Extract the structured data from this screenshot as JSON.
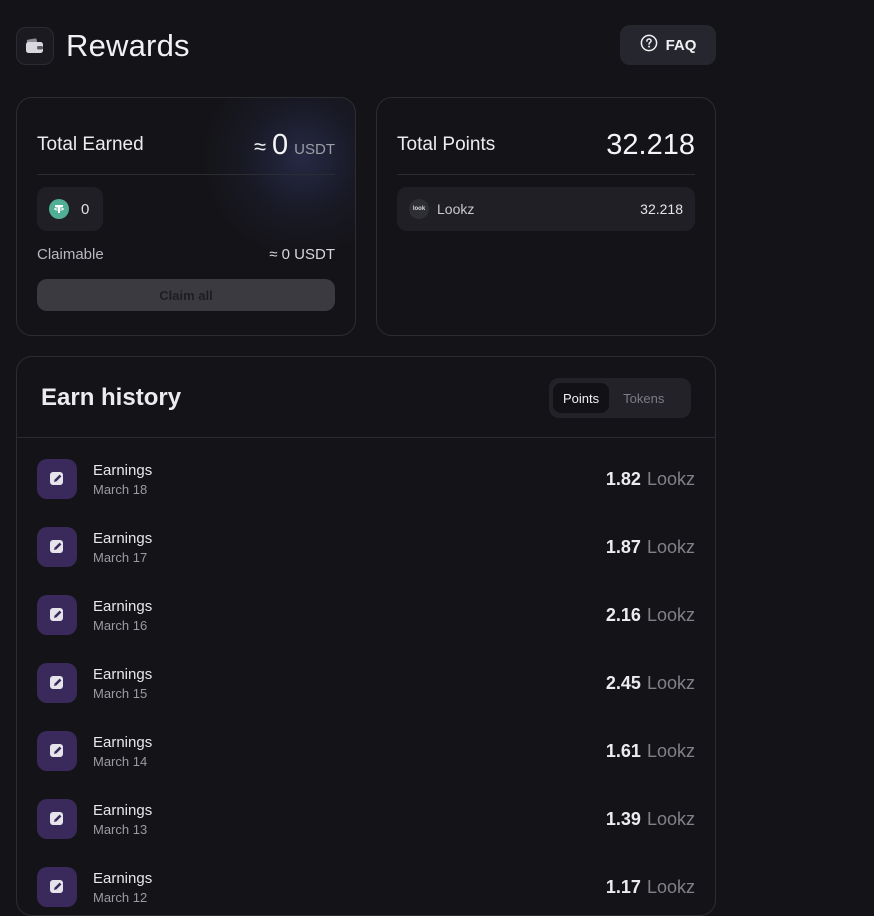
{
  "header": {
    "title": "Rewards",
    "logo_icon": "wallet-icon",
    "faq_label": "FAQ",
    "faq_icon": "question-circle-icon"
  },
  "total_earned": {
    "label": "Total Earned",
    "approx": "≈",
    "value": "0",
    "unit": "USDT",
    "token": {
      "icon": "tether-icon",
      "value": "0"
    },
    "claimable_label": "Claimable",
    "claimable_value": "≈ 0 USDT",
    "claim_button": "Claim all"
  },
  "total_points": {
    "label": "Total Points",
    "value": "32.218",
    "source": {
      "name": "Lookz",
      "logo_text": "look",
      "value": "32.218"
    }
  },
  "history": {
    "title": "Earn history",
    "tabs": [
      {
        "label": "Points",
        "active": true
      },
      {
        "label": "Tokens",
        "active": false
      }
    ],
    "items": [
      {
        "title": "Earnings",
        "date": "March 18",
        "amount": "1.82",
        "unit": "Lookz"
      },
      {
        "title": "Earnings",
        "date": "March 17",
        "amount": "1.87",
        "unit": "Lookz"
      },
      {
        "title": "Earnings",
        "date": "March 16",
        "amount": "2.16",
        "unit": "Lookz"
      },
      {
        "title": "Earnings",
        "date": "March 15",
        "amount": "2.45",
        "unit": "Lookz"
      },
      {
        "title": "Earnings",
        "date": "March 14",
        "amount": "1.61",
        "unit": "Lookz"
      },
      {
        "title": "Earnings",
        "date": "March 13",
        "amount": "1.39",
        "unit": "Lookz"
      },
      {
        "title": "Earnings",
        "date": "March 12",
        "amount": "1.17",
        "unit": "Lookz"
      }
    ]
  },
  "colors": {
    "background": "#141418",
    "card_border": "#2C2C33",
    "item_icon_bg": "#3A2A5C",
    "tether": "#50AF95"
  }
}
